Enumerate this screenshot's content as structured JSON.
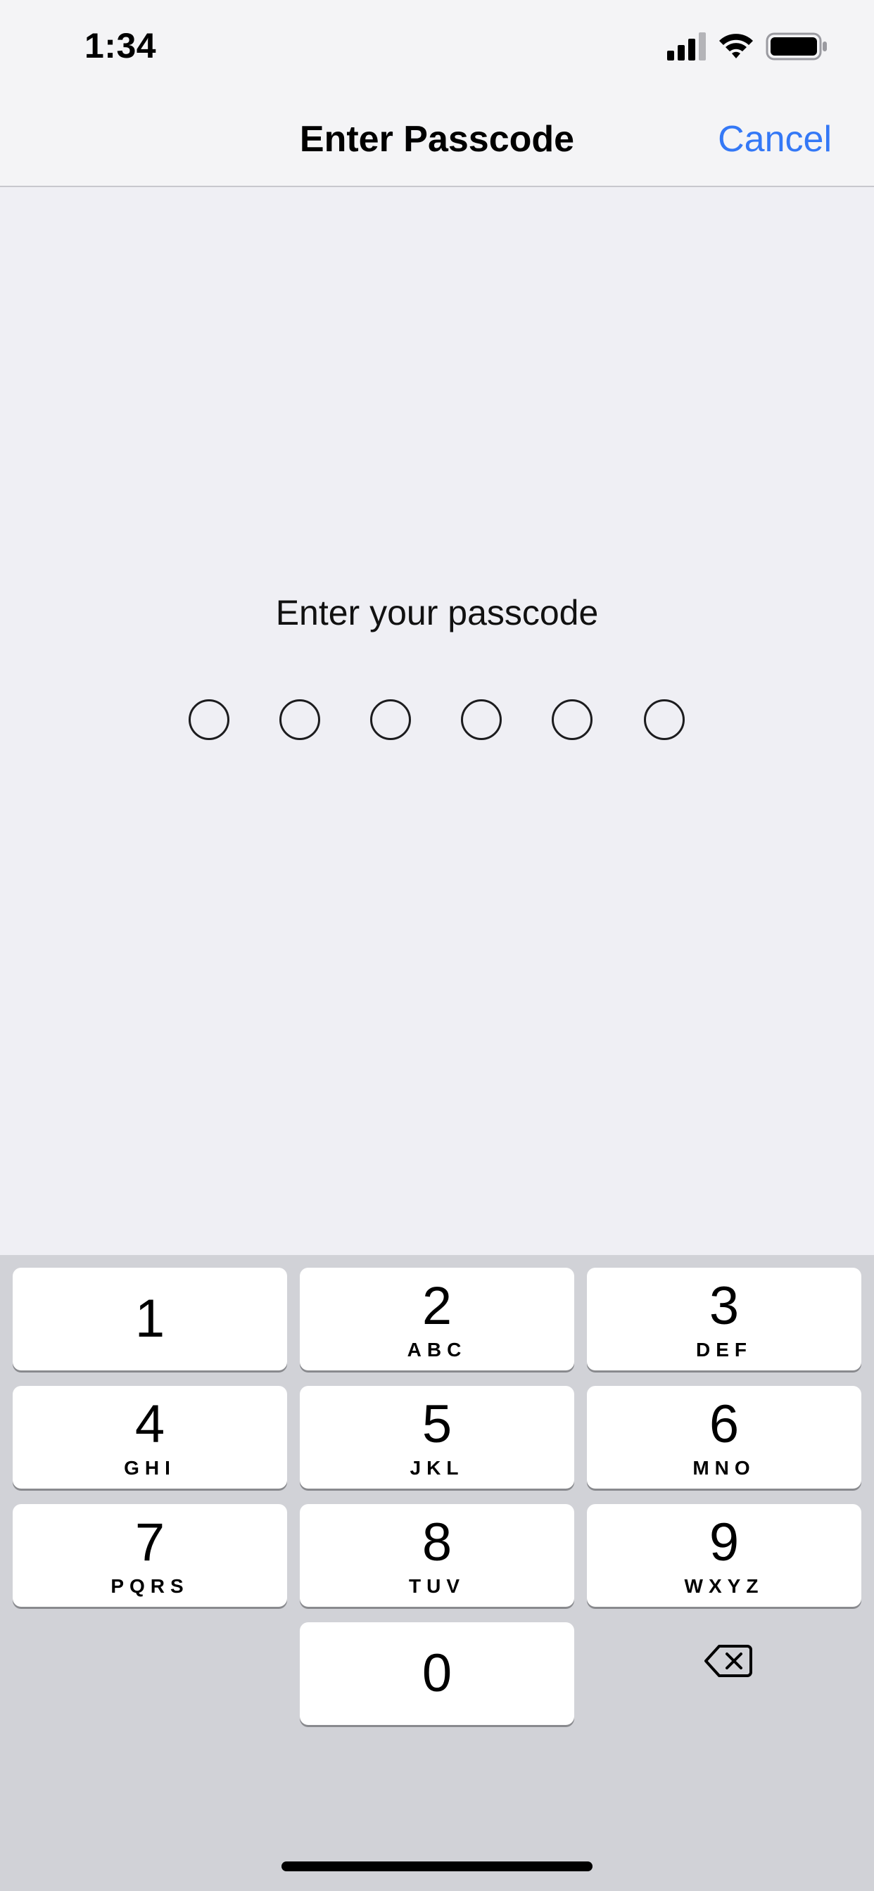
{
  "status_bar": {
    "time": "1:34",
    "icons": [
      "cellular-signal-icon",
      "wifi-icon",
      "battery-icon"
    ]
  },
  "nav": {
    "title": "Enter Passcode",
    "cancel_label": "Cancel",
    "accent_color": "#3478f6"
  },
  "passcode": {
    "prompt": "Enter your passcode",
    "length": 6,
    "entered": 0
  },
  "keypad": {
    "keys": [
      {
        "digit": "1",
        "letters": ""
      },
      {
        "digit": "2",
        "letters": "ABC"
      },
      {
        "digit": "3",
        "letters": "DEF"
      },
      {
        "digit": "4",
        "letters": "GHI"
      },
      {
        "digit": "5",
        "letters": "JKL"
      },
      {
        "digit": "6",
        "letters": "MNO"
      },
      {
        "digit": "7",
        "letters": "PQRS"
      },
      {
        "digit": "8",
        "letters": "TUV"
      },
      {
        "digit": "9",
        "letters": "WXYZ"
      },
      {
        "digit": "0",
        "letters": ""
      }
    ],
    "delete_icon": "backspace-icon"
  }
}
